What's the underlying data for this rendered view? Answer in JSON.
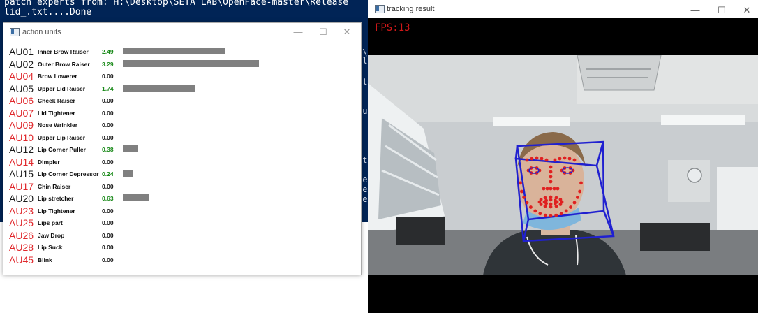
{
  "console": {
    "lines": [
      "patch experts from: H:\\Desktop\\SETA LAB\\OpenFace-master\\Release",
      "lid_.txt....Done"
    ],
    "fragments": [
      "c",
      "s\\",
      "'l",
      "\\t",
      "cu",
      "w",
      "nt",
      "te",
      "te",
      "te"
    ]
  },
  "au_window": {
    "title": "action units",
    "controls": {
      "minimize": "—",
      "maximize": "☐",
      "close": "✕"
    },
    "present_color": "#1a1a1a",
    "absent_color": "#e0282c",
    "value_color": "#1a8a1a",
    "bar_color": "#808080",
    "max_intensity": 5,
    "rows": [
      {
        "code": "AU01",
        "name": "Inner Brow Raiser",
        "value": "2.49",
        "intensity": 2.49,
        "present": true
      },
      {
        "code": "AU02",
        "name": "Outer Brow Raiser",
        "value": "3.29",
        "intensity": 3.29,
        "present": true
      },
      {
        "code": "AU04",
        "name": "Brow Lowerer",
        "value": "0.00",
        "intensity": 0,
        "present": false
      },
      {
        "code": "AU05",
        "name": "Upper Lid Raiser",
        "value": "1.74",
        "intensity": 1.74,
        "present": true
      },
      {
        "code": "AU06",
        "name": "Cheek Raiser",
        "value": "0.00",
        "intensity": 0,
        "present": false
      },
      {
        "code": "AU07",
        "name": "Lid Tightener",
        "value": "0.00",
        "intensity": 0,
        "present": false
      },
      {
        "code": "AU09",
        "name": "Nose Wrinkler",
        "value": "0.00",
        "intensity": 0,
        "present": false
      },
      {
        "code": "AU10",
        "name": "Upper Lip Raiser",
        "value": "0.00",
        "intensity": 0,
        "present": false
      },
      {
        "code": "AU12",
        "name": "Lip Corner Puller",
        "value": "0.38",
        "intensity": 0.38,
        "present": true
      },
      {
        "code": "AU14",
        "name": "Dimpler",
        "value": "0.00",
        "intensity": 0,
        "present": false
      },
      {
        "code": "AU15",
        "name": "Lip Corner Depressor",
        "value": "0.24",
        "intensity": 0.24,
        "present": true
      },
      {
        "code": "AU17",
        "name": "Chin Raiser",
        "value": "0.00",
        "intensity": 0,
        "present": false
      },
      {
        "code": "AU20",
        "name": "Lip stretcher",
        "value": "0.63",
        "intensity": 0.63,
        "present": true
      },
      {
        "code": "AU23",
        "name": "Lip Tightener",
        "value": "0.00",
        "intensity": 0,
        "present": false
      },
      {
        "code": "AU25",
        "name": "Lips part",
        "value": "0.00",
        "intensity": 0,
        "present": false
      },
      {
        "code": "AU26",
        "name": "Jaw Drop",
        "value": "0.00",
        "intensity": 0,
        "present": false
      },
      {
        "code": "AU28",
        "name": "Lip Suck",
        "value": "0.00",
        "intensity": 0,
        "present": false
      },
      {
        "code": "AU45",
        "name": "Blink",
        "value": "0.00",
        "intensity": 0,
        "present": false
      }
    ]
  },
  "tracking_window": {
    "title": "tracking result",
    "controls": {
      "minimize": "—",
      "maximize": "☐",
      "close": "✕"
    },
    "fps_text": "FPS:13",
    "fps_color": "#d01818",
    "box_color": "#2020d0",
    "landmark_color": "#e02020"
  }
}
